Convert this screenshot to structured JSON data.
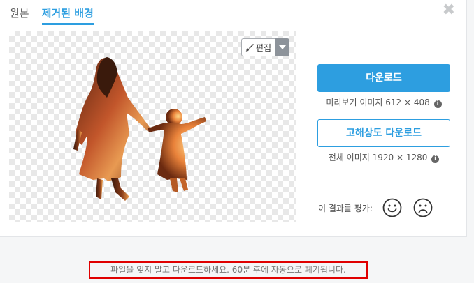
{
  "tabs": [
    {
      "label": "원본",
      "active": false
    },
    {
      "label": "제거된 배경",
      "active": true
    }
  ],
  "close_icon": "close-x",
  "editor": {
    "edit_label": "편집",
    "edit_icon": "brush-icon",
    "caret_icon": "caret-down-icon"
  },
  "download": {
    "primary_label": "다운로드",
    "preview_caption": "미리보기 이미지 612 × 408",
    "hd_label": "고해상도 다운로드",
    "full_caption": "전체 이미지 1920 × 1280"
  },
  "rating": {
    "label": "이 결과를 평가:",
    "positive_icon": "smile-face-icon",
    "negative_icon": "frown-face-icon"
  },
  "notice": "파일을 잊지 말고 다운로드하세요. 60분 후에 자동으로 폐기됩니다.",
  "colors": {
    "accent": "#2d9ee0",
    "highlight_border": "#e00000"
  }
}
